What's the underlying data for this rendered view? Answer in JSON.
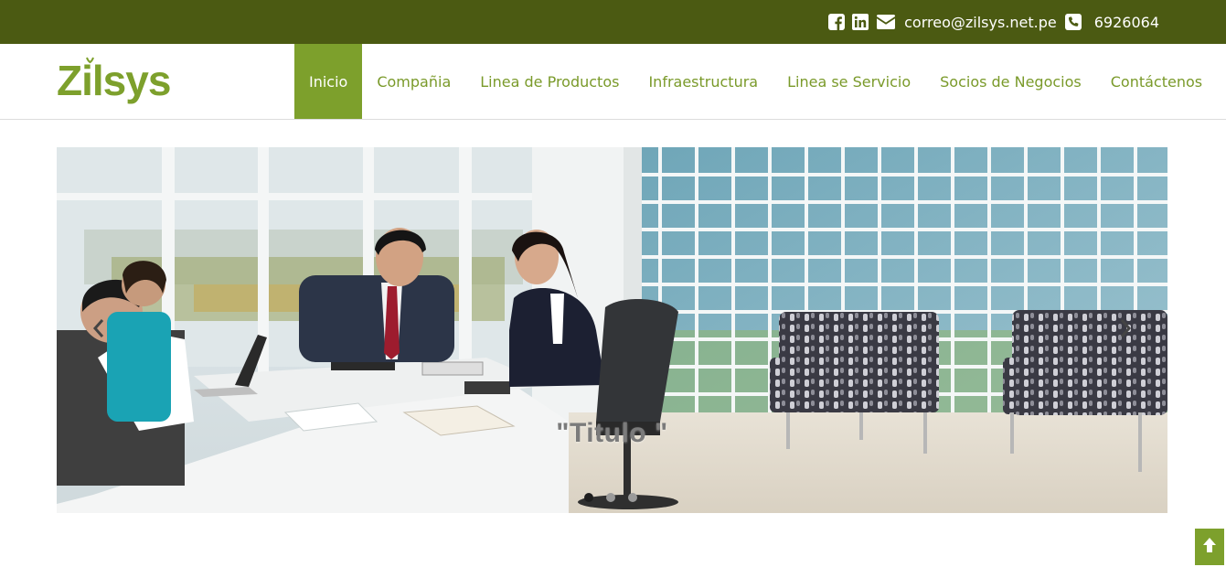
{
  "topbar": {
    "icons": [
      "facebook-icon",
      "linkedin-icon",
      "envelope-icon",
      "phone-icon"
    ],
    "email": "correo@zilsys.net.pe",
    "phone": "6926064",
    "background_color": "#4b5a12"
  },
  "brand": {
    "logo_text": "Zilsys",
    "color": "#7da02c"
  },
  "nav": {
    "items": [
      {
        "label": "Inicio",
        "active": true
      },
      {
        "label": "Compañia",
        "active": false
      },
      {
        "label": "Linea de Productos",
        "active": false
      },
      {
        "label": "Infraestructura",
        "active": false
      },
      {
        "label": "Linea se Servicio",
        "active": false
      },
      {
        "label": "Socios de Negocios",
        "active": false
      },
      {
        "label": "Contáctenos",
        "active": false
      }
    ],
    "text_color": "#7a9a2a",
    "active_color": "#7da02c"
  },
  "slider": {
    "caption": "\"Titulo \"",
    "slide_count": 3,
    "active_index": 0,
    "prev_icon": "chevron-left-icon",
    "next_icon": "chevron-right-icon"
  },
  "back_to_top": {
    "icon": "arrow-up-icon"
  }
}
